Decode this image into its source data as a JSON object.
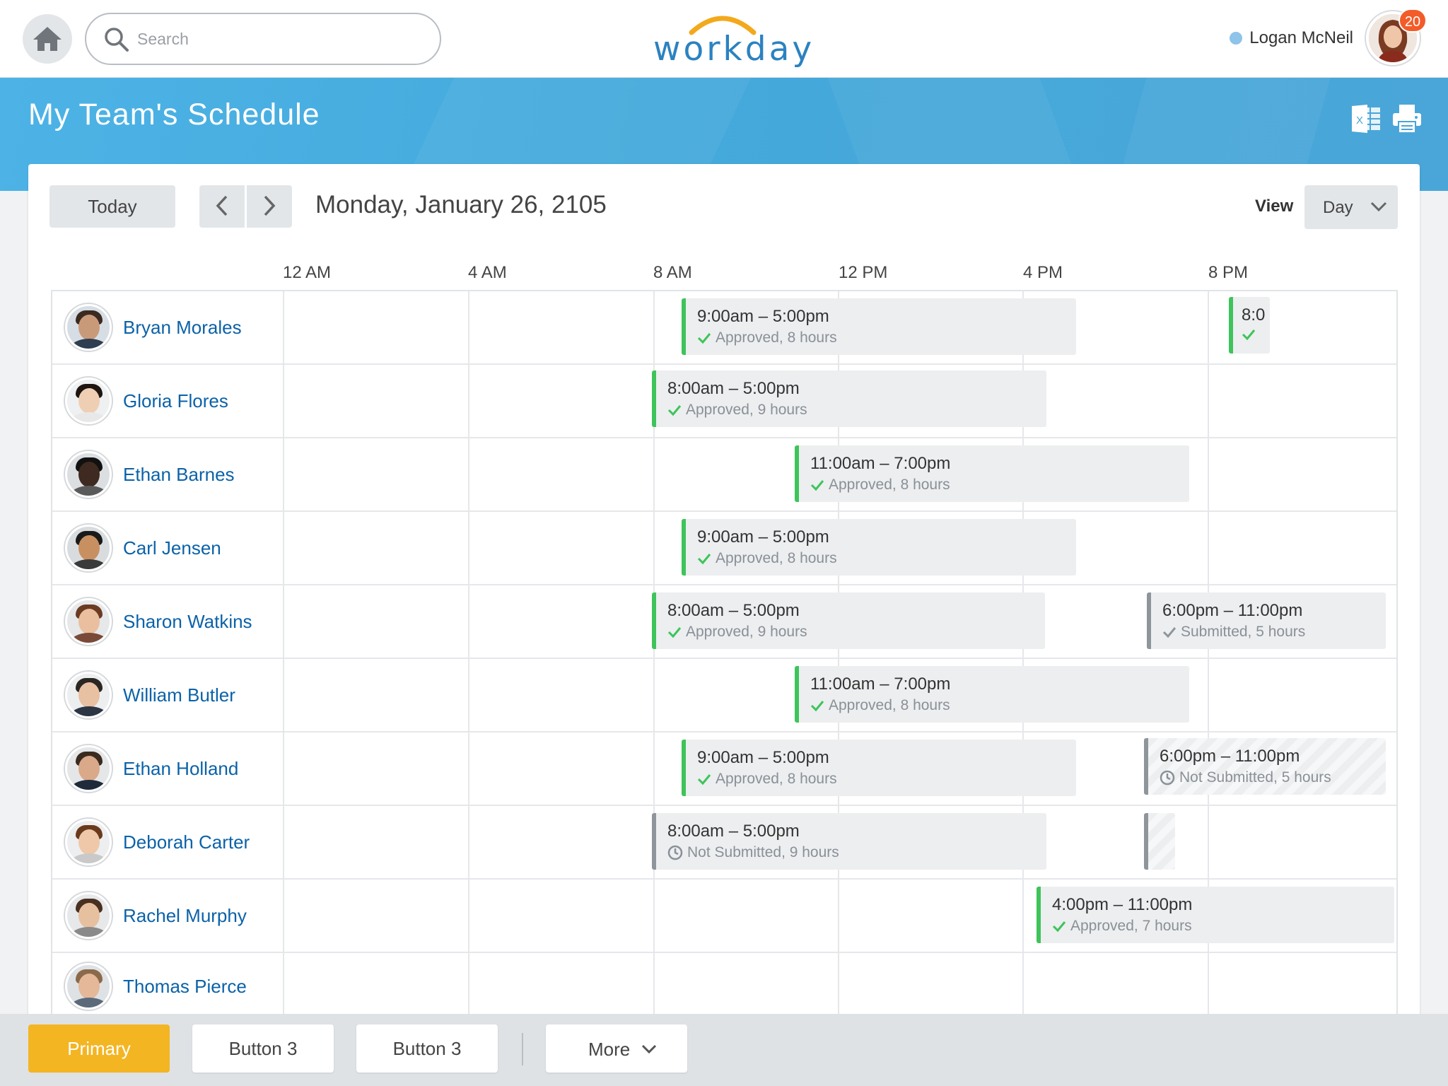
{
  "app": {
    "brand": "workday"
  },
  "header": {
    "search_placeholder": "Search",
    "user_name": "Logan McNeil",
    "notification_count": "20"
  },
  "page": {
    "title": "My Team's Schedule"
  },
  "toolbar": {
    "today_label": "Today",
    "date_label": "Monday, January 26, 2105",
    "view_label": "View",
    "view_value": "Day"
  },
  "timeline": {
    "ticks": [
      "12 AM",
      "4 AM",
      "8 AM",
      "12 PM",
      "4 PM",
      "8 PM"
    ]
  },
  "team": [
    {
      "name": "Bryan Morales"
    },
    {
      "name": "Gloria Flores"
    },
    {
      "name": "Ethan Barnes"
    },
    {
      "name": "Carl Jensen"
    },
    {
      "name": "Sharon Watkins"
    },
    {
      "name": "William Butler"
    },
    {
      "name": "Ethan Holland"
    },
    {
      "name": "Deborah Carter"
    },
    {
      "name": "Rachel Murphy"
    },
    {
      "name": "Thomas Pierce"
    }
  ],
  "shifts": {
    "bryan_1": {
      "time": "9:00am – 5:00pm",
      "status": "Approved, 8 hours"
    },
    "bryan_2": {
      "time": "8:0",
      "status": ""
    },
    "gloria_1": {
      "time": "8:00am – 5:00pm",
      "status": "Approved, 9 hours"
    },
    "ethanb_1": {
      "time": "11:00am – 7:00pm",
      "status": "Approved, 8 hours"
    },
    "carl_1": {
      "time": "9:00am – 5:00pm",
      "status": "Approved, 8 hours"
    },
    "sharon_1": {
      "time": "8:00am – 5:00pm",
      "status": "Approved, 9 hours"
    },
    "sharon_2": {
      "time": "6:00pm – 11:00pm",
      "status": "Submitted, 5 hours"
    },
    "william_1": {
      "time": "11:00am – 7:00pm",
      "status": "Approved, 8 hours"
    },
    "ethanh_1": {
      "time": "9:00am – 5:00pm",
      "status": "Approved, 8 hours"
    },
    "ethanh_2": {
      "time": "6:00pm – 11:00pm",
      "status": "Not Submitted, 5 hours"
    },
    "deborah_1": {
      "time": "8:00am – 5:00pm",
      "status": "Not Submitted, 9 hours"
    },
    "rachel_1": {
      "time": "4:00pm – 11:00pm",
      "status": "Approved, 7 hours"
    }
  },
  "colors": {
    "approved": "#3ec45a",
    "pending": "#8e959b",
    "header_band": "#4db3e6",
    "primary_button": "#f4b523",
    "link": "#0b62a8",
    "badge": "#f35b28"
  },
  "icons": [
    "home-icon",
    "search-icon",
    "excel-icon",
    "print-icon",
    "chevron-left-icon",
    "chevron-right-icon",
    "chevron-down-icon",
    "check-icon",
    "clock-icon"
  ],
  "actions": {
    "primary": "Primary",
    "button_a": "Button 3",
    "button_b": "Button 3",
    "more": "More"
  }
}
